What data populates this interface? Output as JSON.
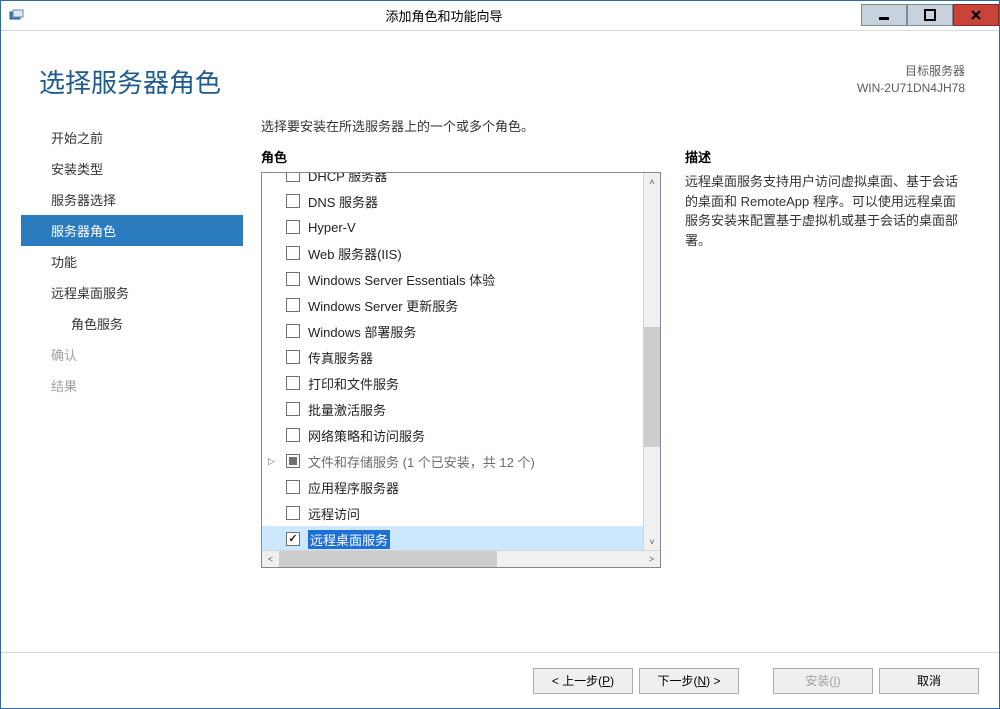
{
  "window": {
    "title": "添加角色和功能向导"
  },
  "header": {
    "page_title": "选择服务器角色",
    "target_label": "目标服务器",
    "target_value": "WIN-2U71DN4JH78"
  },
  "sidebar": {
    "items": [
      {
        "label": "开始之前",
        "state": "normal"
      },
      {
        "label": "安装类型",
        "state": "normal"
      },
      {
        "label": "服务器选择",
        "state": "normal"
      },
      {
        "label": "服务器角色",
        "state": "active"
      },
      {
        "label": "功能",
        "state": "normal"
      },
      {
        "label": "远程桌面服务",
        "state": "normal"
      },
      {
        "label": "角色服务",
        "state": "sub"
      },
      {
        "label": "确认",
        "state": "disabled"
      },
      {
        "label": "结果",
        "state": "disabled"
      }
    ]
  },
  "main": {
    "instruction": "选择要安装在所选服务器上的一个或多个角色。",
    "roles_header": "角色",
    "desc_header": "描述",
    "description": "远程桌面服务支持用户访问虚拟桌面、基于会话的桌面和 RemoteApp 程序。可以使用远程桌面服务安装来配置基于虚拟机或基于会话的桌面部署。",
    "roles": [
      {
        "label": "DHCP 服务器",
        "checked": false,
        "partial_top": true
      },
      {
        "label": "DNS 服务器",
        "checked": false
      },
      {
        "label": "Hyper-V",
        "checked": false
      },
      {
        "label": "Web 服务器(IIS)",
        "checked": false
      },
      {
        "label": "Windows Server Essentials 体验",
        "checked": false
      },
      {
        "label": "Windows Server 更新服务",
        "checked": false
      },
      {
        "label": "Windows 部署服务",
        "checked": false
      },
      {
        "label": "传真服务器",
        "checked": false
      },
      {
        "label": "打印和文件服务",
        "checked": false
      },
      {
        "label": "批量激活服务",
        "checked": false
      },
      {
        "label": "网络策略和访问服务",
        "checked": false
      },
      {
        "label": "文件和存储服务 (1 个已安装，共 12 个)",
        "checked": "indeterminate",
        "expandable": true,
        "dim": true
      },
      {
        "label": "应用程序服务器",
        "checked": false
      },
      {
        "label": "远程访问",
        "checked": false
      },
      {
        "label": "远程桌面服务",
        "checked": true,
        "selected": true
      }
    ]
  },
  "footer": {
    "prev": "< 上一步(P)",
    "next": "下一步(N) >",
    "install": "安装(I)",
    "cancel": "取消"
  }
}
